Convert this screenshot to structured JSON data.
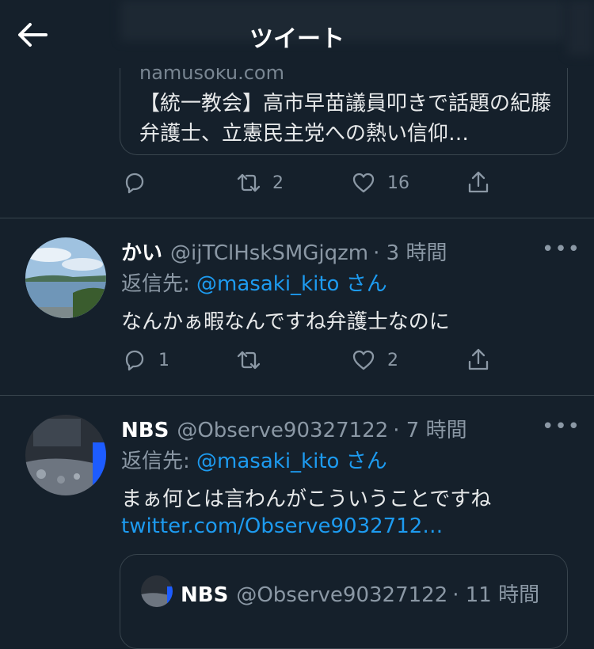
{
  "header": {
    "title": "ツイート"
  },
  "link_card": {
    "domain": "namusoku.com",
    "title": "【統一教会】高市早苗議員叩きで話題の紀藤弁護士、立憲民主党への熱い信仰…"
  },
  "first_actions": {
    "reply": "",
    "retweet": "2",
    "like": "16"
  },
  "tweets": [
    {
      "name": "かい",
      "handle": "@ijTClHskSMGjqzm",
      "time": "· 3 時間",
      "reply_prefix": "返信先: ",
      "reply_mention": "@masaki_kito",
      "reply_suffix": " さん",
      "text": "なんかぁ暇なんですね弁護士なのに",
      "actions": {
        "reply": "1",
        "retweet": "",
        "like": "2"
      }
    },
    {
      "name": "NBS",
      "handle": "@Observe90327122",
      "time": "· 7 時間",
      "reply_prefix": "返信先: ",
      "reply_mention": "@masaki_kito",
      "reply_suffix": " さん",
      "text": "まぁ何とは言わんがこういうことですね",
      "link": "twitter.com/Observe9032712…",
      "quote": {
        "name": "NBS",
        "handle": "@Observe90327122",
        "time": "· 11 時間"
      }
    }
  ],
  "more_label": "•••"
}
